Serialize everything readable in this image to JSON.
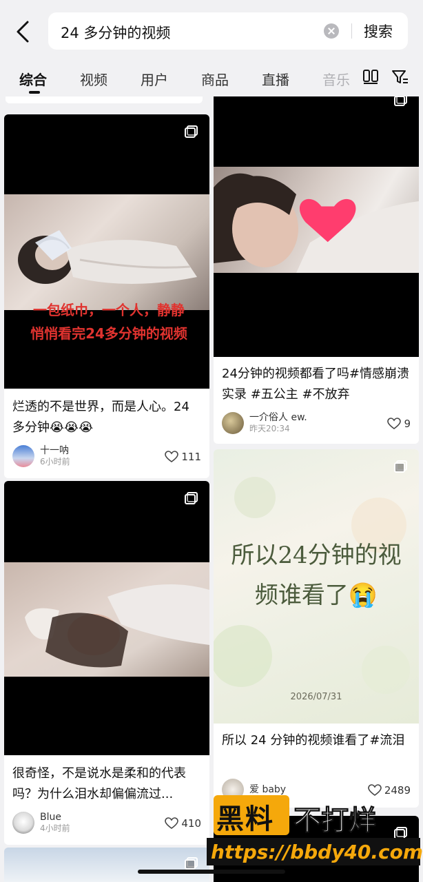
{
  "search": {
    "query": "24 多分钟的视频",
    "button": "搜索"
  },
  "tabs": [
    "综合",
    "视频",
    "用户",
    "商品",
    "直播",
    "音乐"
  ],
  "cards": [
    {
      "overlay": [
        "一包纸巾，一个人，静静",
        "悄悄看完24多分钟的视频"
      ],
      "title": "烂透的不是世界，而是人心。24 多分钟😭😭😭",
      "author": "十一呐",
      "time": "6小时前",
      "likes": "111"
    },
    {
      "title": "24分钟的视频都看了吗#情感崩溃实录 #五公主 #不放弃",
      "author": "一介俗人 ew.",
      "time": "昨天20:34",
      "likes": "9"
    },
    {
      "title": "很奇怪，不是说水是柔和的代表吗？为什么泪水却偏偏流过...",
      "author": "Blue",
      "time": "4小时前",
      "likes": "410"
    },
    {
      "overlay": [
        "所以24分钟的视",
        "频谁看了😭",
        "2026/07/31"
      ],
      "title": "所以 24 分钟的视频谁看了#流泪",
      "author": "爱 baby",
      "likes": "2489"
    }
  ],
  "watermark": {
    "brand_a": "黑料",
    "brand_b": "不打烊",
    "url": "https://bbdy40.com"
  }
}
